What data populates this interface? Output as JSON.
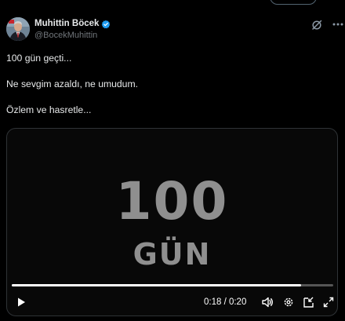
{
  "post": {
    "author_name": "Muhittin Böcek",
    "author_handle": "@BocekMuhittin",
    "lines": [
      "100 gün geçti...",
      "Ne sevgim azaldı, ne umudum.",
      "Özlem ve hasretle..."
    ]
  },
  "video": {
    "overlay_number": "100",
    "overlay_label": "GÜN",
    "time_display": "0:18 / 0:20",
    "progress": 0.9
  },
  "icons": {
    "verified": "verified-badge-icon",
    "grok": "grok-icon",
    "more": "more-icon",
    "play": "play-icon",
    "volume": "volume-icon",
    "settings": "settings-icon",
    "dock": "dock-icon",
    "fullscreen": "fullscreen-icon"
  },
  "colors": {
    "background": "#000000",
    "text": "#e7e9ea",
    "muted": "#71767b",
    "verified": "#1d9bf0",
    "overlay_text": "#8f8f8f"
  }
}
